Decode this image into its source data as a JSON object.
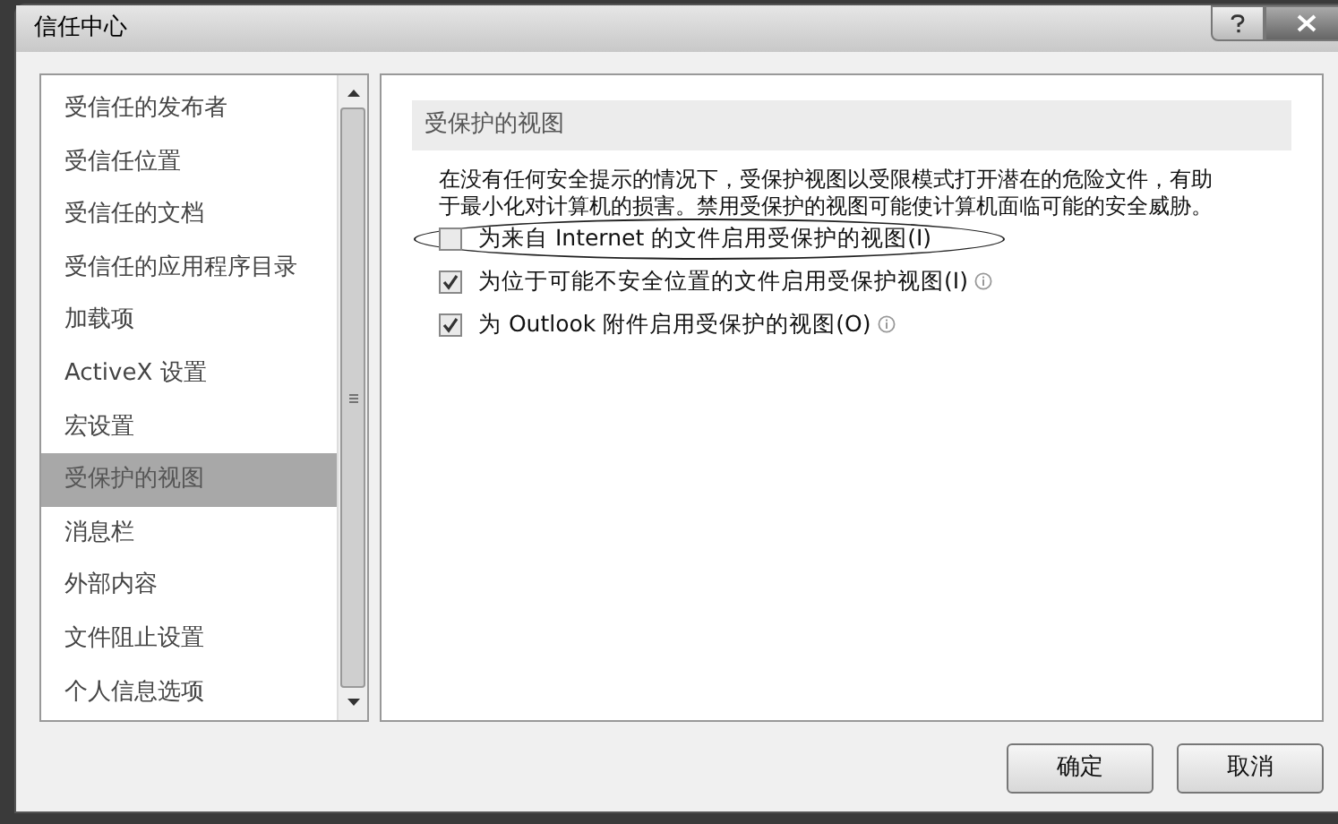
{
  "window": {
    "title": "信任中心"
  },
  "sidebar": {
    "items": [
      {
        "label": "受信任的发布者",
        "selected": false
      },
      {
        "label": "受信任位置",
        "selected": false
      },
      {
        "label": "受信任的文档",
        "selected": false
      },
      {
        "label": "受信任的应用程序目录",
        "selected": false
      },
      {
        "label": "加载项",
        "selected": false
      },
      {
        "label": "ActiveX 设置",
        "selected": false
      },
      {
        "label": "宏设置",
        "selected": false
      },
      {
        "label": "受保护的视图",
        "selected": true
      },
      {
        "label": "消息栏",
        "selected": false
      },
      {
        "label": "外部内容",
        "selected": false
      },
      {
        "label": "文件阻止设置",
        "selected": false
      },
      {
        "label": "个人信息选项",
        "selected": false
      }
    ]
  },
  "panel": {
    "heading": "受保护的视图",
    "description": "在没有任何安全提示的情况下，受保护视图以受限模式打开潜在的危险文件，有助于最小化对计算机的损害。禁用受保护的视图可能使计算机面临可能的安全威胁。",
    "options": [
      {
        "label": "为来自 Internet 的文件启用受保护的视图(I)",
        "checked": false,
        "info": false,
        "circled": true
      },
      {
        "label": "为位于可能不安全位置的文件启用受保护视图(I)",
        "checked": true,
        "info": true,
        "circled": false
      },
      {
        "label": "为 Outlook 附件启用受保护的视图(O)",
        "checked": true,
        "info": true,
        "circled": false
      }
    ]
  },
  "buttons": [
    {
      "label": "确定"
    },
    {
      "label": "取消"
    }
  ]
}
